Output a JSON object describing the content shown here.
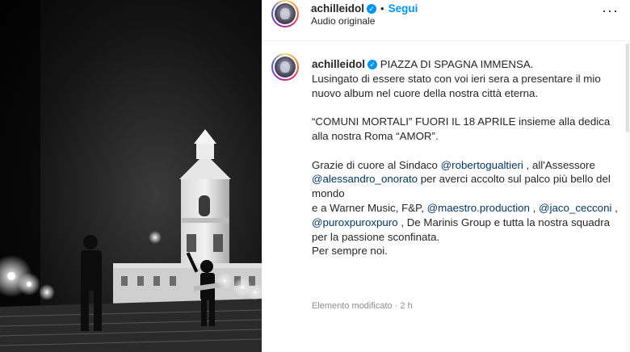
{
  "post": {
    "username": "achilleidol",
    "verified_glyph": "✓",
    "dot": "•",
    "follow_label": "Segui",
    "audio_label": "Audio originale",
    "more_glyph": "···"
  },
  "caption": {
    "username": "achilleidol",
    "line1": "PIAZZA DI SPAGNA IMMENSA.",
    "line2": "Lusingato di essere stato con voi ieri sera a presentare il mio nuovo album nel cuore della nostra città eterna.",
    "line3": "“COMUNI MORTALI” FUORI IL 18 APRILE insieme alla dedica alla nostra Roma “AMOR”.",
    "p4_text1": "Grazie di cuore al Sindaco ",
    "mention1": "@robertogualtieri",
    "p4_text2": " , all'Assessore ",
    "mention2": "@alessandro_onorato",
    "p4_text3": " per averci accolto sul palco più bello del mondo",
    "p5_text1": "e a Warner Music, F&P, ",
    "mention3": "@maestro.production",
    "p5_text2": " , ",
    "mention4": "@jaco_cecconi",
    "p5_text3": " , ",
    "mention5": "@puroxpuroxpuro",
    "p5_text4": " , De Marinis Group e tutta la nostra squadra per la passione sconfinata.",
    "closing": "Per sempre noi.",
    "meta": "Elemento modificato · 2 h"
  },
  "icons": [
    "verified-icon",
    "more-options-icon",
    "avatar"
  ],
  "colors": {
    "link": "#0095f6",
    "mention": "#00376b",
    "muted": "#8e8e8e"
  }
}
